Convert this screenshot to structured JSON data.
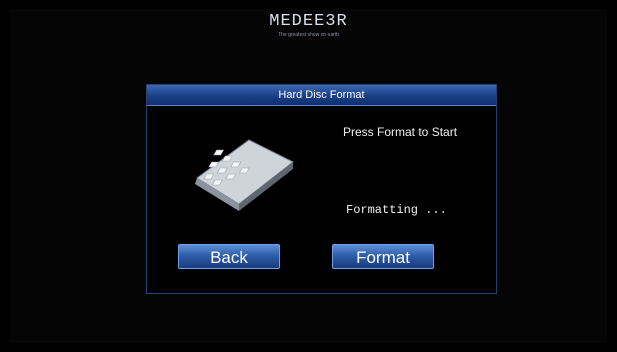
{
  "logo": {
    "brand": "MEDEE3R",
    "tagline": "The greatest show on earth"
  },
  "dialog": {
    "title": "Hard Disc Format",
    "prompt": "Press Format to Start",
    "status": "Formatting ..."
  },
  "buttons": {
    "back": "Back",
    "format": "Format"
  },
  "colors": {
    "title_bar": "#1f4a90",
    "button": "#2c5aa6",
    "background": "#000000"
  }
}
